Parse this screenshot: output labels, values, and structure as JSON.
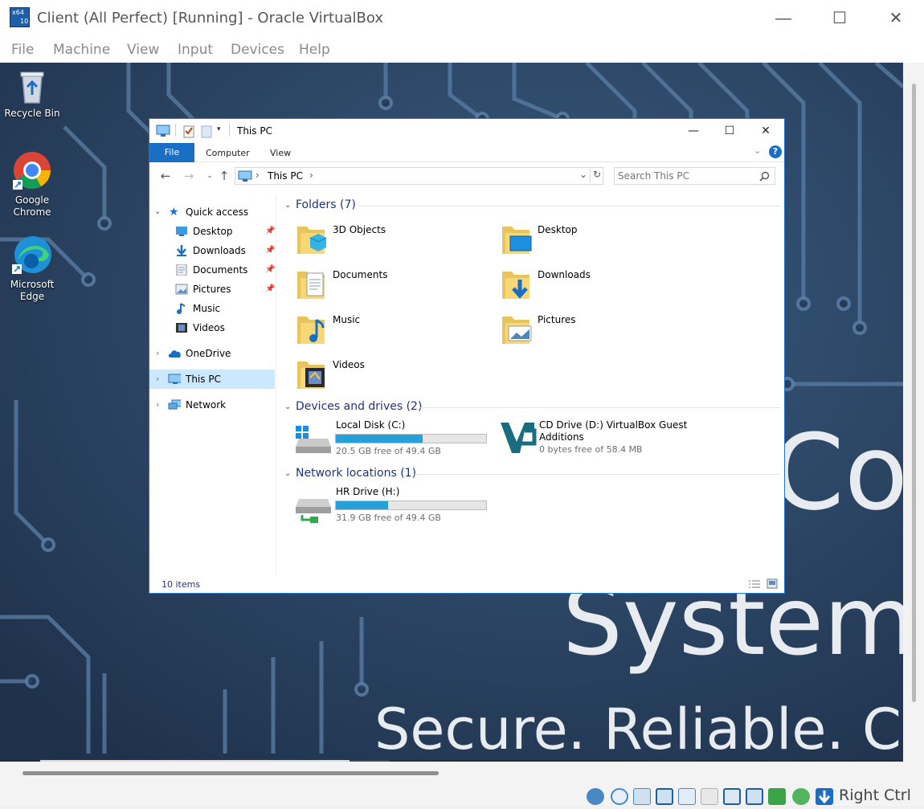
{
  "window": {
    "title": "Client (All Perfect) [Running] - Oracle VirtualBox",
    "logo_text": [
      "x64",
      "10"
    ],
    "controls": {
      "minimize": "—",
      "maximize": "☐",
      "close": "✕"
    }
  },
  "menu": [
    "File",
    "Machine",
    "View",
    "Input",
    "Devices",
    "Help"
  ],
  "desktop": {
    "icons": [
      {
        "label": "Recycle Bin",
        "icon": "recycle-bin-icon"
      },
      {
        "label": "Google Chrome",
        "icon": "chrome-icon"
      },
      {
        "label": "Microsoft Edge",
        "icon": "edge-icon"
      }
    ],
    "wallpaper_text": {
      "line1": "Co",
      "line2": "System",
      "line3": "Secure. Reliable. Co"
    }
  },
  "explorer": {
    "title": "This PC",
    "controls": {
      "minimize": "—",
      "maximize": "☐",
      "close": "✕"
    },
    "ribbon": {
      "file": "File",
      "tabs": [
        "Computer",
        "View"
      ],
      "help": "?"
    },
    "address": {
      "location": "This PC",
      "separator": "›"
    },
    "search": {
      "placeholder": "Search This PC"
    },
    "nav": {
      "quick_access": "Quick access",
      "items": [
        {
          "label": "Desktop",
          "pinned": true,
          "icon": "desktop-icon"
        },
        {
          "label": "Downloads",
          "pinned": true,
          "icon": "downloads-icon"
        },
        {
          "label": "Documents",
          "pinned": true,
          "icon": "documents-icon"
        },
        {
          "label": "Pictures",
          "pinned": true,
          "icon": "pictures-icon"
        },
        {
          "label": "Music",
          "pinned": false,
          "icon": "music-icon"
        },
        {
          "label": "Videos",
          "pinned": false,
          "icon": "videos-icon"
        }
      ],
      "onedrive": "OneDrive",
      "this_pc": "This PC",
      "network": "Network"
    },
    "groups": {
      "folders": {
        "title": "Folders (7)",
        "items": [
          "3D Objects",
          "Desktop",
          "Documents",
          "Downloads",
          "Music",
          "Pictures",
          "Videos"
        ]
      },
      "devices": {
        "title": "Devices and drives (2)",
        "items": [
          {
            "name": "Local Disk (C:)",
            "free": "20.5 GB free of 49.4 GB",
            "used_fraction": 0.58
          },
          {
            "name_line1": "CD Drive (D:) VirtualBox Guest",
            "name_line2": "Additions",
            "free": "0 bytes free of 58.4 MB"
          }
        ]
      },
      "network": {
        "title": "Network locations (1)",
        "items": [
          {
            "name": "HR Drive (H:)",
            "free": "31.9 GB free of 49.4 GB",
            "used_fraction": 0.35
          }
        ]
      }
    },
    "status": "10 items"
  },
  "statusbar": {
    "host_key": "Right Ctrl"
  },
  "colors": {
    "accent": "#1a6fc4",
    "selected": "#cce8ff",
    "group_head": "#1e3287",
    "drive_fill": "#26a0da",
    "desktop": "#243a57"
  }
}
